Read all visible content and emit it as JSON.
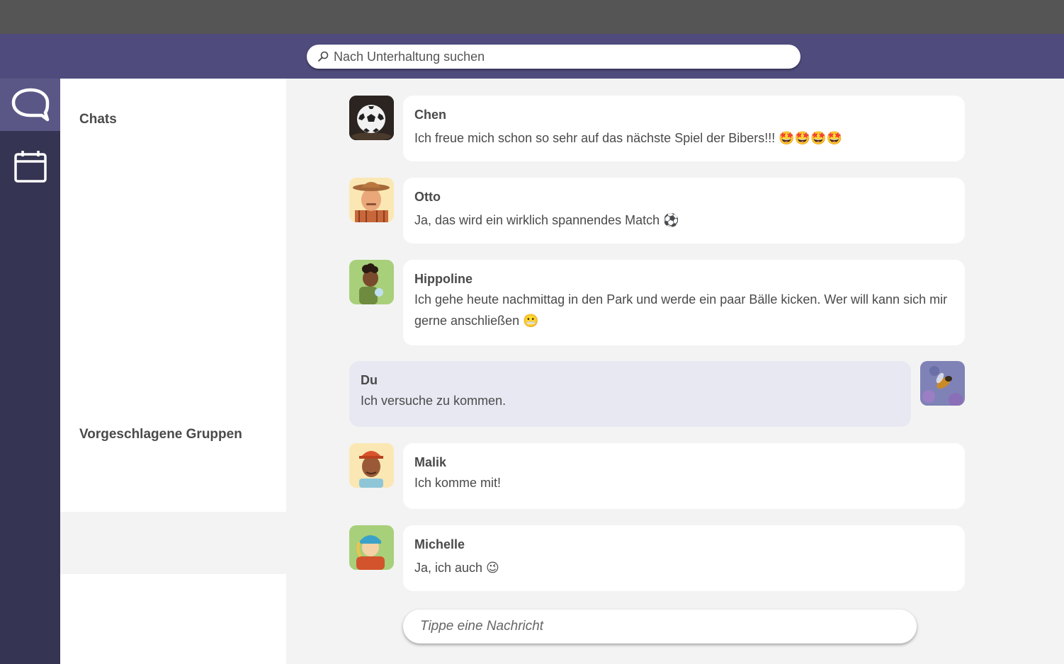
{
  "search": {
    "placeholder": "Nach Unterhaltung suchen"
  },
  "rail": {
    "items": [
      {
        "name": "chats",
        "icon": "chat-bubble-icon",
        "active": true
      },
      {
        "name": "calendar",
        "icon": "calendar-icon",
        "active": false
      }
    ]
  },
  "sidebar": {
    "chats_title": "Chats",
    "groups_title": "Vorgeschlagene Gruppen"
  },
  "messages": [
    {
      "author": "Chen",
      "text": "Ich freue mich schon so sehr auf das nächste Spiel der Bibers!!! 🤩🤩🤩🤩",
      "avatar": "soccer-ball-avatar",
      "own": false
    },
    {
      "author": "Otto",
      "text": "Ja, das wird ein wirklich spannendes Match ⚽",
      "avatar": "farmer-avatar",
      "own": false
    },
    {
      "author": "Hippoline",
      "text": "Ich gehe heute nachmittag in den Park und werde ein paar Bälle kicken. Wer will kann sich mir gerne anschließen 😬",
      "avatar": "hiker-avatar",
      "own": false
    },
    {
      "author": "Du",
      "text": "Ich versuche zu kommen.",
      "avatar": "bee-avatar",
      "own": true
    },
    {
      "author": "Malik",
      "text": "Ich komme mit!",
      "avatar": "boy-cap-avatar",
      "own": false
    },
    {
      "author": "Michelle",
      "text": "Ja, ich auch 😉",
      "avatar": "girl-cap-avatar",
      "own": false
    }
  ],
  "composer": {
    "placeholder": "Tippe eine Nachricht"
  },
  "colors": {
    "header": "#4f4c7d",
    "rail": "#353452",
    "rail_active": "#5a5787",
    "own_bubble": "#e8e8f3"
  }
}
